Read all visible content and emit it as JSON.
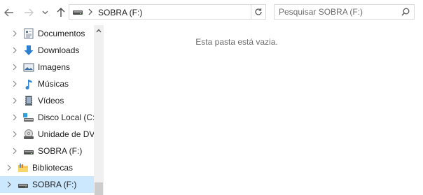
{
  "toolbar": {
    "address_path": "SOBRA (F:)",
    "search_placeholder": "Pesquisar SOBRA (F:)"
  },
  "icons": {
    "back": "arrow-left-icon",
    "forward": "arrow-right-icon",
    "recent": "chevron-down-icon",
    "up": "arrow-up-icon",
    "refresh": "refresh-icon",
    "search": "search-icon"
  },
  "sidebar": {
    "items": [
      {
        "label": "Documentos",
        "icon": "documents-icon"
      },
      {
        "label": "Downloads",
        "icon": "downloads-icon"
      },
      {
        "label": "Imagens",
        "icon": "pictures-icon"
      },
      {
        "label": "Músicas",
        "icon": "music-icon"
      },
      {
        "label": "Vídeos",
        "icon": "videos-icon"
      },
      {
        "label": "Disco Local (C:",
        "icon": "local-disk-icon"
      },
      {
        "label": "Unidade de DV",
        "icon": "dvd-drive-icon"
      },
      {
        "label": "SOBRA (F:)",
        "icon": "usb-drive-icon"
      },
      {
        "label": "Bibliotecas",
        "icon": "libraries-icon"
      },
      {
        "label": "SOBRA (F:)",
        "icon": "usb-drive-icon",
        "selected": true
      }
    ]
  },
  "content": {
    "empty_message": "Esta pasta está vazia."
  },
  "colors": {
    "selection": "#cce8ff",
    "border": "#d9d9d9",
    "muted_text": "#6d6d6d"
  }
}
